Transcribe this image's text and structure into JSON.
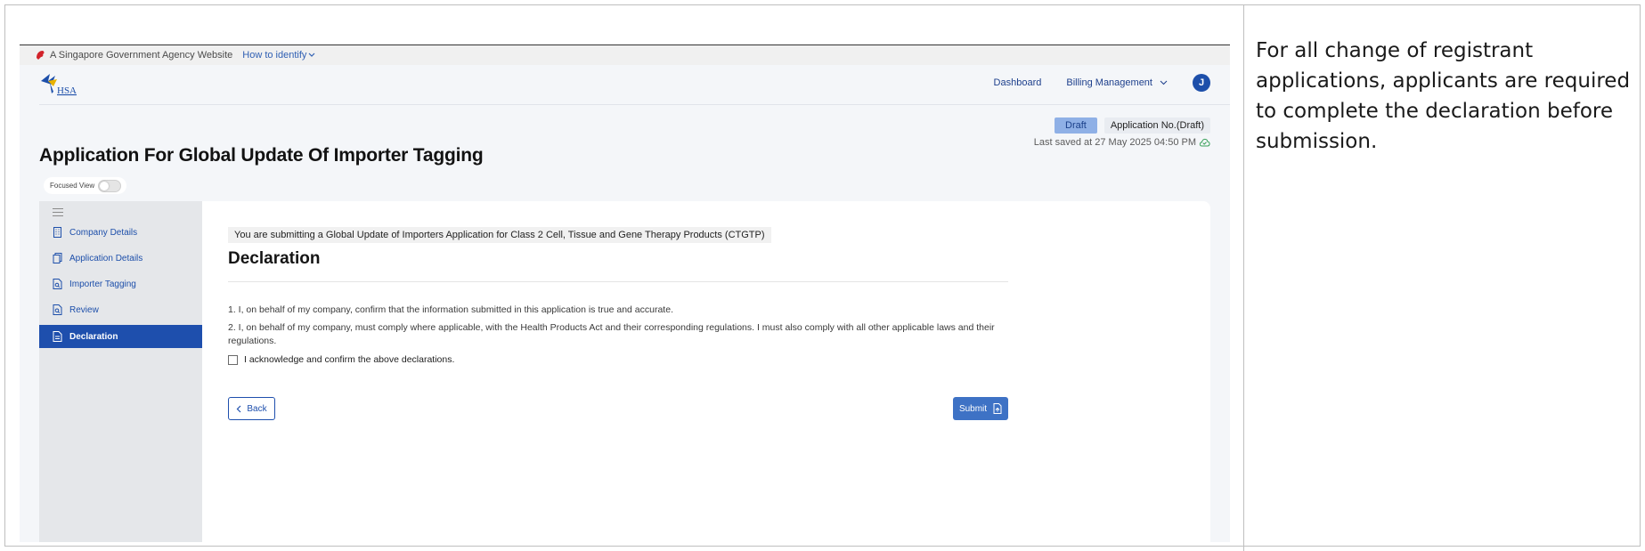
{
  "gov_banner": {
    "text": "A Singapore Government Agency Website",
    "link": "How to identify"
  },
  "header": {
    "logo_text": "HSA",
    "nav": {
      "dashboard": "Dashboard",
      "billing": "Billing Management",
      "avatar_initial": "J"
    }
  },
  "page": {
    "title": "Application For Global Update Of Importer Tagging",
    "status_badge": "Draft",
    "application_no": "Application No.(Draft)",
    "last_saved": "Last saved at 27 May 2025 04:50 PM"
  },
  "focused_view": {
    "label": "Focused View",
    "enabled": false
  },
  "sidebar": {
    "items": [
      {
        "label": "Company Details",
        "icon": "building-icon",
        "active": false
      },
      {
        "label": "Application Details",
        "icon": "documents-icon",
        "active": false
      },
      {
        "label": "Importer Tagging",
        "icon": "document-search-icon",
        "active": false
      },
      {
        "label": "Review",
        "icon": "document-review-icon",
        "active": false
      },
      {
        "label": "Declaration",
        "icon": "document-icon",
        "active": true
      }
    ]
  },
  "declaration": {
    "info": "You are submitting a Global Update of Importers Application for Class 2 Cell, Tissue and Gene Therapy Products (CTGTP)",
    "title": "Declaration",
    "statement_1": "1. I, on behalf of my company, confirm that the information submitted in this application is true and accurate.",
    "statement_2": "2. I, on behalf of my company, must comply where applicable, with the Health Products Act and their corresponding regulations. I must also comply with all other applicable laws and their regulations.",
    "acknowledge_label": "I acknowledge and confirm the above declarations.",
    "acknowledged": false
  },
  "actions": {
    "back": "Back",
    "submit": "Submit"
  },
  "note": {
    "text": "For all change of registrant applications, applicants are required to complete the declaration before submission."
  },
  "colors": {
    "primary": "#1e4fad",
    "draft_badge": "#8fb0e6",
    "submit_button": "#3e72c5"
  }
}
